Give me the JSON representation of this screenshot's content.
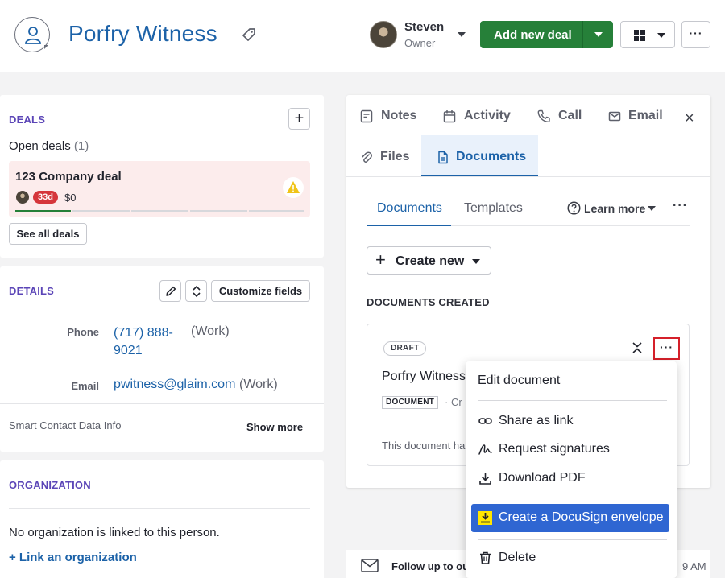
{
  "header": {
    "person_name": "Porfry Witness",
    "owner_name": "Steven",
    "owner_role": "Owner",
    "add_deal_label": "Add new deal",
    "more_glyph": "···",
    "icons": [
      "person-icon",
      "tag-icon",
      "grid-view-icon"
    ],
    "accent_color": "#268039"
  },
  "deals": {
    "section_title": "DEALS",
    "open_label": "Open deals",
    "open_count": "(1)",
    "plus_glyph": "+",
    "card": {
      "title": "123 Company deal",
      "days_badge": "33d",
      "amount": "$0",
      "warning_color": "#f0c419"
    },
    "see_all_label": "See all deals"
  },
  "details": {
    "section_title": "DETAILS",
    "customize_label": "Customize fields",
    "phone_label": "Phone",
    "phone_value": "(717) 888-9021",
    "phone_type": "(Work)",
    "email_label": "Email",
    "email_value": "pwitness@glaim.com",
    "email_type": "(Work)",
    "smart_info": "Smart Contact Data Info",
    "show_more": "Show more"
  },
  "organization": {
    "section_title": "ORGANIZATION",
    "empty_text": "No organization is linked to this person.",
    "link_label": "+ Link an organization"
  },
  "right_panel": {
    "tabs": {
      "notes": "Notes",
      "activity": "Activity",
      "call": "Call",
      "email": "Email",
      "files": "Files",
      "documents": "Documents"
    },
    "close_glyph": "×",
    "subtabs": {
      "documents": "Documents",
      "templates": "Templates"
    },
    "learn_more": "Learn more",
    "more_glyph": "···",
    "create_new": "Create new",
    "docs_created_title": "DOCUMENTS CREATED",
    "doc_card": {
      "status": "DRAFT",
      "title": "Porfry Witness",
      "type_badge": "DOCUMENT",
      "subtitle": "·  Cr",
      "description": "This document ha",
      "more_glyph": "···"
    }
  },
  "follow_up": {
    "text": "Follow up to ou",
    "time": "9 AM"
  },
  "menu": {
    "edit": "Edit document",
    "share": "Share as link",
    "request": "Request signatures",
    "download": "Download PDF",
    "docusign": "Create a DocuSign envelope",
    "delete": "Delete",
    "highlight_color": "#2f66d2"
  }
}
